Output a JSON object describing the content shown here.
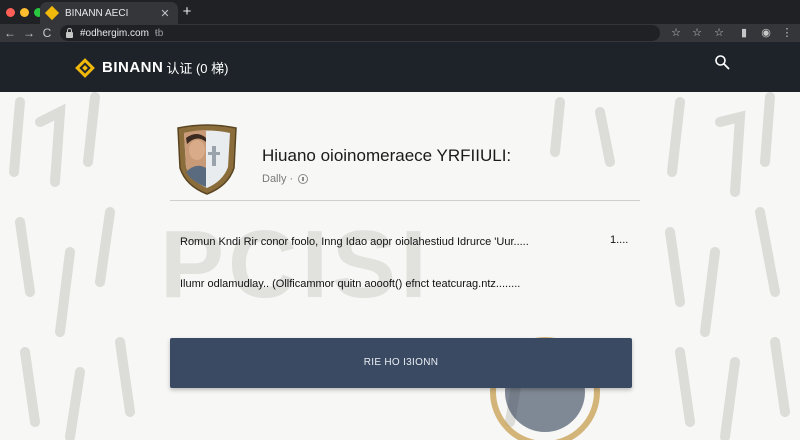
{
  "browser": {
    "tab_title": "BINANN AECI",
    "tab_close": "✕",
    "new_tab": "+",
    "url": "#odhergim.com",
    "url_suffix": "ŧb",
    "nav": {
      "back": "←",
      "forward": "→",
      "reload": "C"
    },
    "toolbar_icons": [
      "star-icon",
      "star-icon",
      "star-icon",
      "page-icon",
      "profile-icon",
      "menu-icon"
    ]
  },
  "header": {
    "brand_name": "BINANN",
    "brand_suffix": "认证 (0 梯)",
    "accent_color": "#f0b90b",
    "background": "#1e2329"
  },
  "card": {
    "title": "Hiuano oioinomeraece YRFIIULI:",
    "meta_label": "Dally ·",
    "line1": "Romun Kndi Rir conor foolo, Inng Idao aopr oiolahestiud Idrurce 'Uur.....",
    "line1_count": "1....",
    "line2": "Ilumr odlamudlay.. (Ollficammor quitn aoooft() efnct teatcurag.ntz........"
  },
  "cta": {
    "label": "RIE HO I3IONN",
    "color": "#3a4a63"
  },
  "background_text": "PCISI"
}
